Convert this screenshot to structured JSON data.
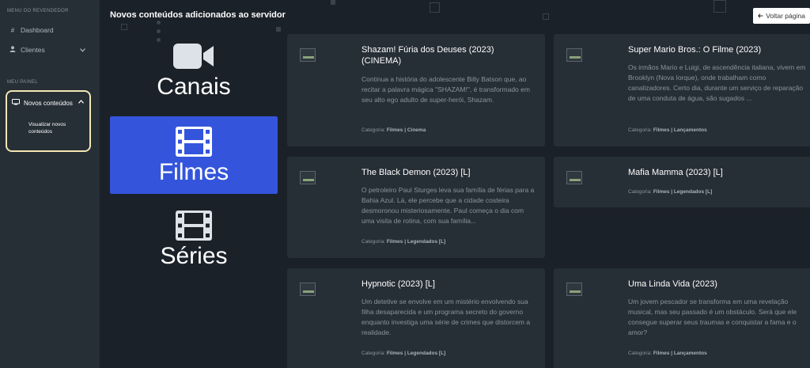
{
  "sidebar": {
    "section_reseller": "MENU DO REVENDEDOR",
    "dashboard": "Dashboard",
    "clients": "Clientes",
    "section_panel": "MEU PAINEL",
    "new_contents": "Novos conteúdos",
    "view_new_contents": "Visualizar novos conteúdos"
  },
  "header": {
    "title": "Novos conteúdos adicionados ao servidor",
    "back_button": "Voltar página"
  },
  "categories": [
    {
      "label": "Canais",
      "icon": "video-camera-icon",
      "active": false
    },
    {
      "label": "Filmes",
      "icon": "film-icon",
      "active": true
    },
    {
      "label": "Séries",
      "icon": "film-icon",
      "active": false
    }
  ],
  "cards": [
    {
      "title": "Shazam! Fúria dos Deuses (2023) (CINEMA)",
      "description": "Continua a história do adolescente Billy Batson que, ao recitar a palavra mágica \"SHAZAM!\", é transformado em seu alto ego adulto de super-herói, Shazam.",
      "category_prefix": "Categoria:",
      "category": "Filmes | Cinema"
    },
    {
      "title": "Super Mario Bros.: O Filme (2023)",
      "description": "Os irmãos Mario e Luigi, de ascendência italiana, vivem em Brooklyn (Nova Iorque), onde trabalham como canalizadores. Certo dia, durante um serviço de reparação de uma conduta de água, são sugados ...",
      "category_prefix": "Categoria:",
      "category": "Filmes | Lançamentos"
    },
    {
      "title": "The Black Demon (2023) [L]",
      "description": "O petroleiro Paul Sturges leva sua família de férias para a Bahia Azul. Lá, ele percebe que a cidade costeira desmoronou misteriosamente. Paul começa o dia com uma visita de rotina, com sua família...",
      "category_prefix": "Categoria:",
      "category": "Filmes | Legendados [L]"
    },
    {
      "title": "Mafia Mamma (2023) [L]",
      "description": "",
      "category_prefix": "Categoria:",
      "category": "Filmes | Legendados [L]"
    },
    {
      "title": "Hypnotic (2023) [L]",
      "description": "Um detetive se envolve em um mistério envolvendo sua filha desaparecida e um programa secreto do governo enquanto investiga uma série de crimes que distorcem a realidade.",
      "category_prefix": "Categoria:",
      "category": "Filmes | Legendados [L]"
    },
    {
      "title": "Uma Linda Vida (2023)",
      "description": "Um jovem pescador se transforma em uma revelação musical, mas seu passado é um obstáculo. Será que ele consegue superar seus traumas e conquistar a fama e o amor?",
      "category_prefix": "Categoria:",
      "category": "Filmes | Lançamentos"
    }
  ]
}
